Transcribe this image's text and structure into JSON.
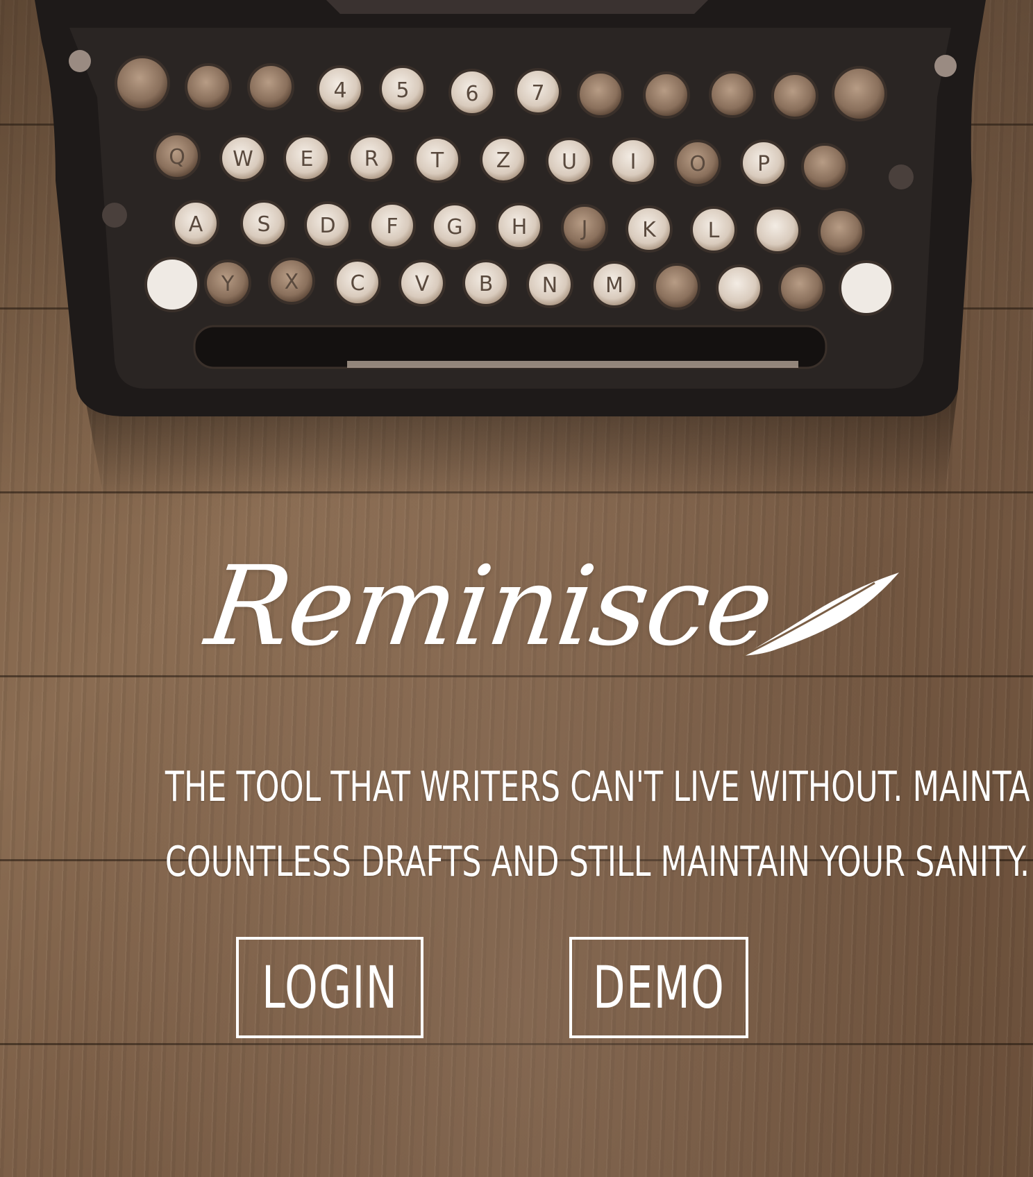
{
  "app": {
    "logo_text": "Reminisce",
    "tagline_lines": [
      "The tool that writers can't live without. Maintain",
      "countless drafts and still maintain your sanity."
    ]
  },
  "actions": {
    "login_label": "LOGIN",
    "demo_label": "DEMO"
  },
  "icons": {
    "logo_decoration": "quill-icon",
    "hero_image": "typewriter-illustration"
  },
  "colors": {
    "text": "#ffffff",
    "wood": "#7a5e45",
    "typewriter_body": "#1f1c1b",
    "key_face": "#e8dfd6"
  },
  "typewriter_keys": {
    "row1": [
      "",
      "",
      "",
      "4",
      "5",
      "6",
      "7",
      "",
      "",
      "",
      "",
      ""
    ],
    "row2": [
      "Q",
      "W",
      "E",
      "R",
      "T",
      "Z",
      "U",
      "I",
      "O",
      "P",
      ""
    ],
    "row3": [
      "A",
      "S",
      "D",
      "F",
      "G",
      "H",
      "J",
      "K",
      "L",
      "",
      ""
    ],
    "row4": [
      "",
      "Y",
      "X",
      "C",
      "V",
      "B",
      "N",
      "M",
      "",
      "",
      "",
      ""
    ]
  }
}
